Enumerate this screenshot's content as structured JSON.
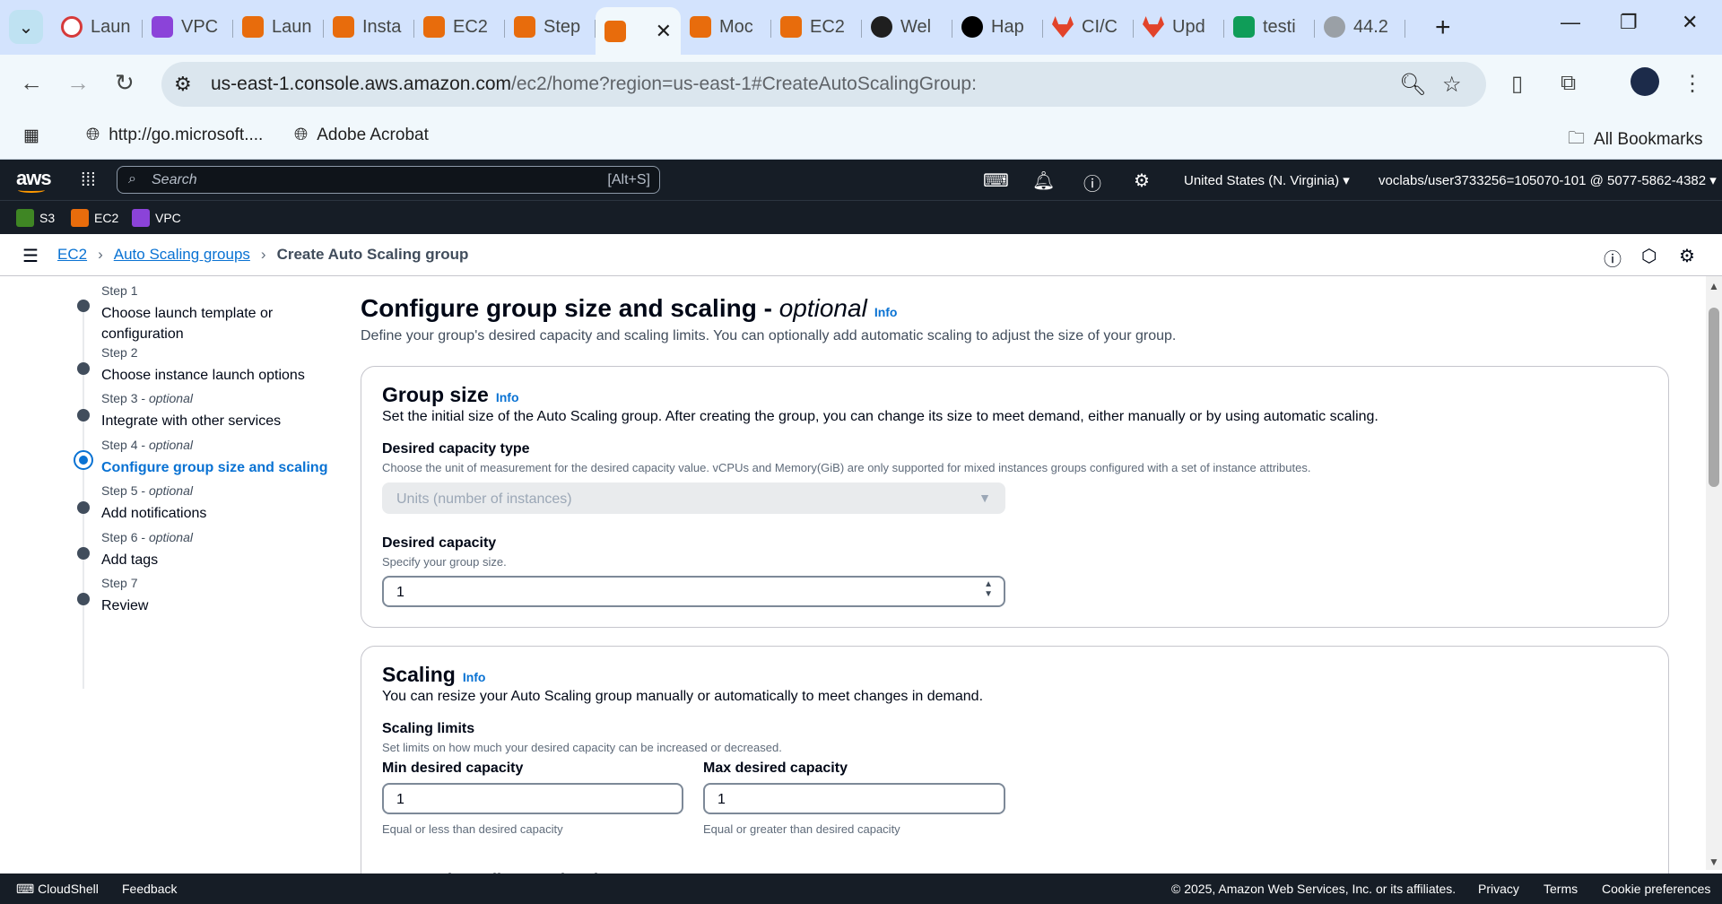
{
  "browser": {
    "tabs": [
      {
        "label": "Laun",
        "icon": "red-ring-icon"
      },
      {
        "label": "VPC",
        "icon": "vpc-icon"
      },
      {
        "label": "Laun",
        "icon": "aws-ec2-icon"
      },
      {
        "label": "Insta",
        "icon": "aws-ec2-icon"
      },
      {
        "label": "EC2",
        "icon": "aws-cube-icon"
      },
      {
        "label": "Step",
        "icon": "aws-ec2-icon"
      },
      {
        "label": "",
        "icon": "aws-ec2-icon",
        "active": true
      },
      {
        "label": "Moc",
        "icon": "aws-ec2-icon"
      },
      {
        "label": "EC2",
        "icon": "aws-cube-icon"
      },
      {
        "label": "Wel",
        "icon": "github-icon"
      },
      {
        "label": "Hap",
        "icon": "openai-icon"
      },
      {
        "label": "CI/C",
        "icon": "gitlab-icon"
      },
      {
        "label": "Upd",
        "icon": "gitlab-check-icon"
      },
      {
        "label": "testi",
        "icon": "sheets-plus-icon"
      },
      {
        "label": "44.2",
        "icon": "globe-icon"
      }
    ],
    "url_host": "us-east-1.console.aws.amazon.com",
    "url_path": "/ec2/home?region=us-east-1#CreateAutoScalingGroup:",
    "bookmarks": [
      {
        "label": "http://go.microsoft....",
        "icon": "globe-icon"
      },
      {
        "label": "Adobe Acrobat",
        "icon": "globe-icon"
      }
    ],
    "all_bookmarks_label": "All Bookmarks"
  },
  "aws": {
    "search_placeholder": "Search",
    "search_shortcut": "[Alt+S]",
    "region": "United States (N. Virginia) ▾",
    "account": "voclabs/user3733256=105070-101 @ 5077-5862-4382 ▾",
    "services": [
      "S3",
      "EC2",
      "VPC"
    ],
    "colors": {
      "nav_bg": "#161d26",
      "link": "#0972d3",
      "s3": "#3f8624",
      "ec2": "#e86c0c",
      "vpc": "#8b43d9"
    }
  },
  "breadcrumb": {
    "items": [
      "EC2",
      "Auto Scaling groups"
    ],
    "current": "Create Auto Scaling group"
  },
  "steps": [
    {
      "label": "Step 1",
      "optional": "",
      "name": "Choose launch template or configuration"
    },
    {
      "label": "Step 2",
      "optional": "",
      "name": "Choose instance launch options"
    },
    {
      "label": "Step 3",
      "optional": "optional",
      "name": "Integrate with other services"
    },
    {
      "label": "Step 4",
      "optional": "optional",
      "name": "Configure group size and scaling",
      "active": true
    },
    {
      "label": "Step 5",
      "optional": "optional",
      "name": "Add notifications"
    },
    {
      "label": "Step 6",
      "optional": "optional",
      "name": "Add tags"
    },
    {
      "label": "Step 7",
      "optional": "",
      "name": "Review"
    }
  ],
  "page": {
    "title": "Configure group size and scaling -",
    "title_optional": "optional",
    "info": "Info",
    "description": "Define your group's desired capacity and scaling limits. You can optionally add automatic scaling to adjust the size of your group."
  },
  "group_size": {
    "title": "Group size",
    "info": "Info",
    "description": "Set the initial size of the Auto Scaling group. After creating the group, you can change its size to meet demand, either manually or by using automatic scaling.",
    "capacity_type_label": "Desired capacity type",
    "capacity_type_desc": "Choose the unit of measurement for the desired capacity value. vCPUs and Memory(GiB) are only supported for mixed instances groups configured with a set of instance attributes.",
    "capacity_type_value": "Units (number of instances)",
    "desired_label": "Desired capacity",
    "desired_desc": "Specify your group size.",
    "desired_value": "1"
  },
  "scaling": {
    "title": "Scaling",
    "info": "Info",
    "description": "You can resize your Auto Scaling group manually or automatically to meet changes in demand.",
    "limits_label": "Scaling limits",
    "limits_desc": "Set limits on how much your desired capacity can be increased or decreased.",
    "min_label": "Min desired capacity",
    "min_value": "1",
    "min_hint": "Equal or less than desired capacity",
    "max_label": "Max desired capacity",
    "max_value": "1",
    "max_hint": "Equal or greater than desired capacity",
    "next_section": "Automatic scaling - optional"
  },
  "footer": {
    "cloudshell": "CloudShell",
    "feedback": "Feedback",
    "copyright": "© 2025, Amazon Web Services, Inc. or its affiliates.",
    "privacy": "Privacy",
    "terms": "Terms",
    "cookies": "Cookie preferences"
  }
}
